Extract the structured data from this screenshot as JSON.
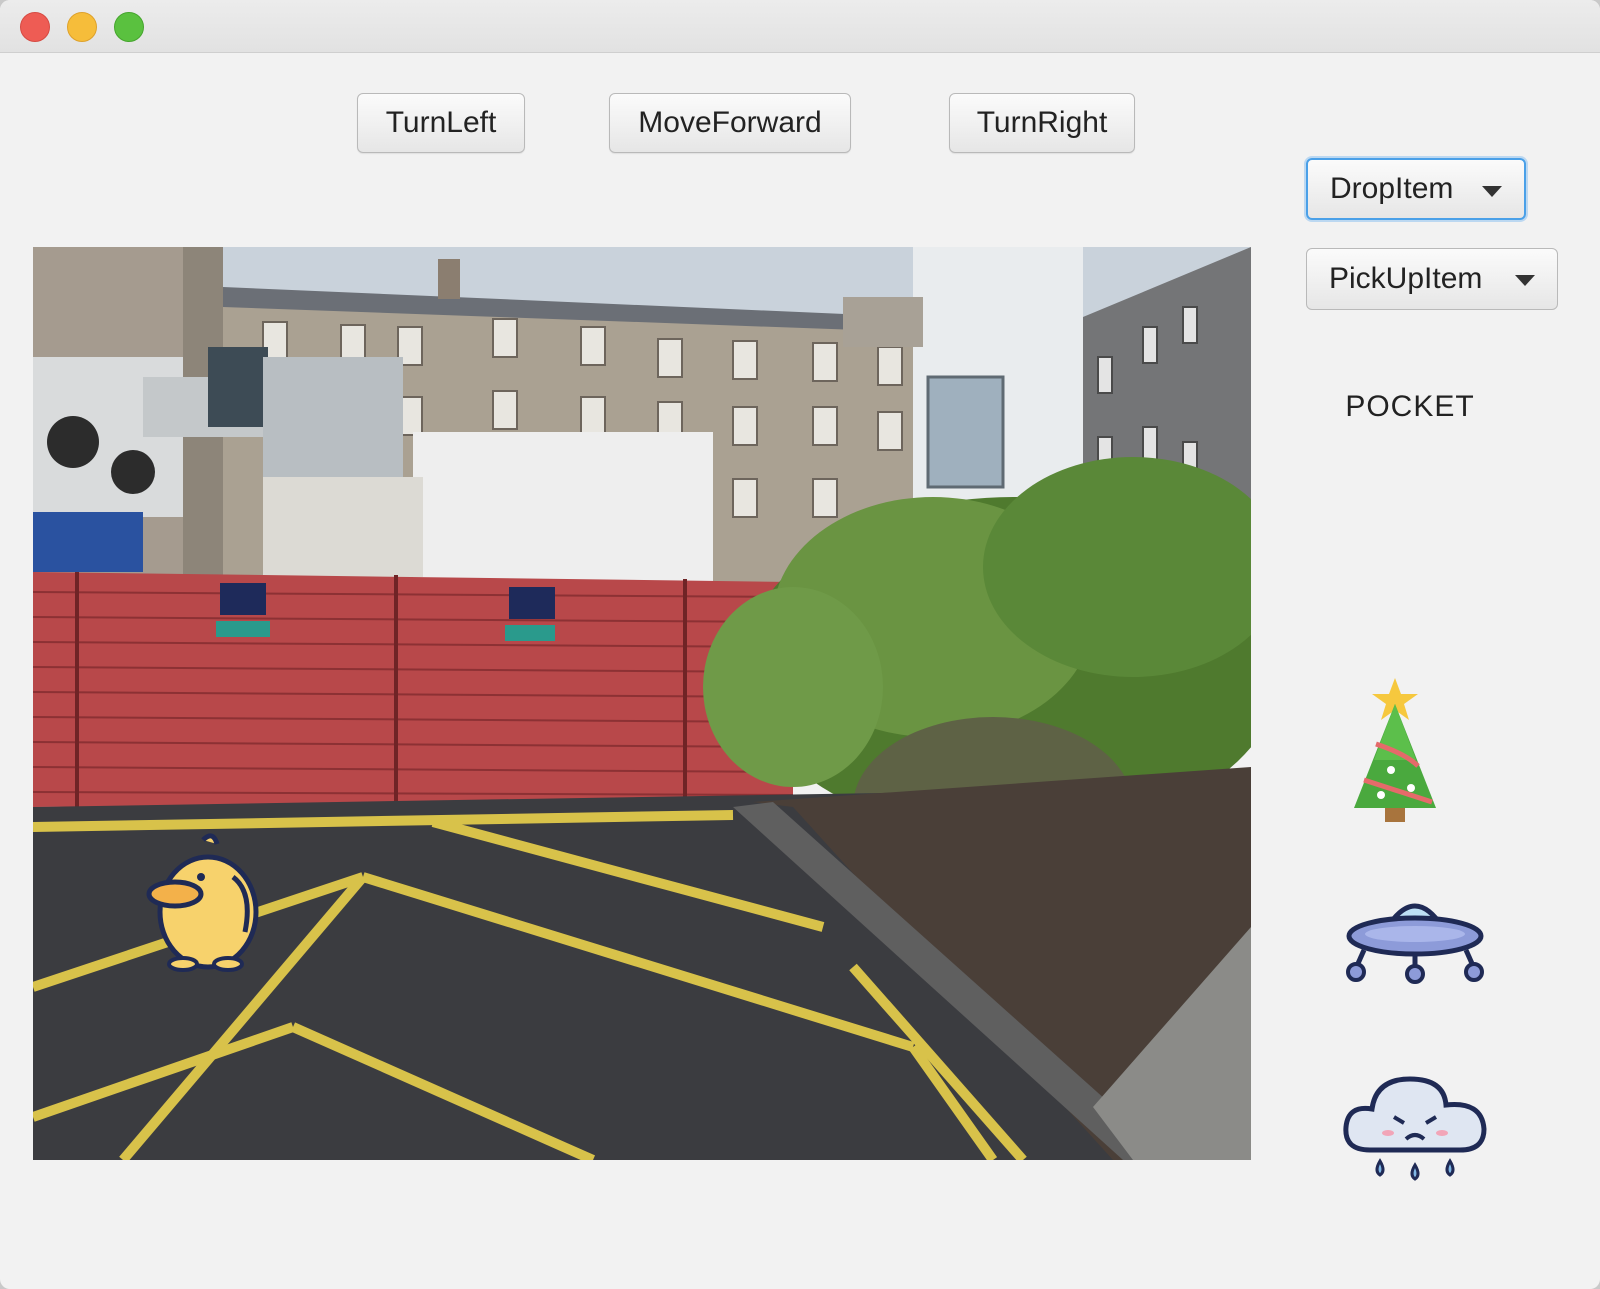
{
  "window": {
    "title": ""
  },
  "controls": {
    "turn_left": "TurnLeft",
    "move_forward": "MoveForward",
    "turn_right": "TurnRight"
  },
  "dropdowns": {
    "drop_item": {
      "selected": "DropItem"
    },
    "pick_up_item": {
      "selected": "PickUpItem"
    }
  },
  "pocket": {
    "label": "POCKET",
    "items": [
      "christmas-tree-icon",
      "ufo-icon",
      "rain-cloud-icon"
    ]
  },
  "scene": {
    "description_icon": "street-photo",
    "character": "duck-icon"
  }
}
